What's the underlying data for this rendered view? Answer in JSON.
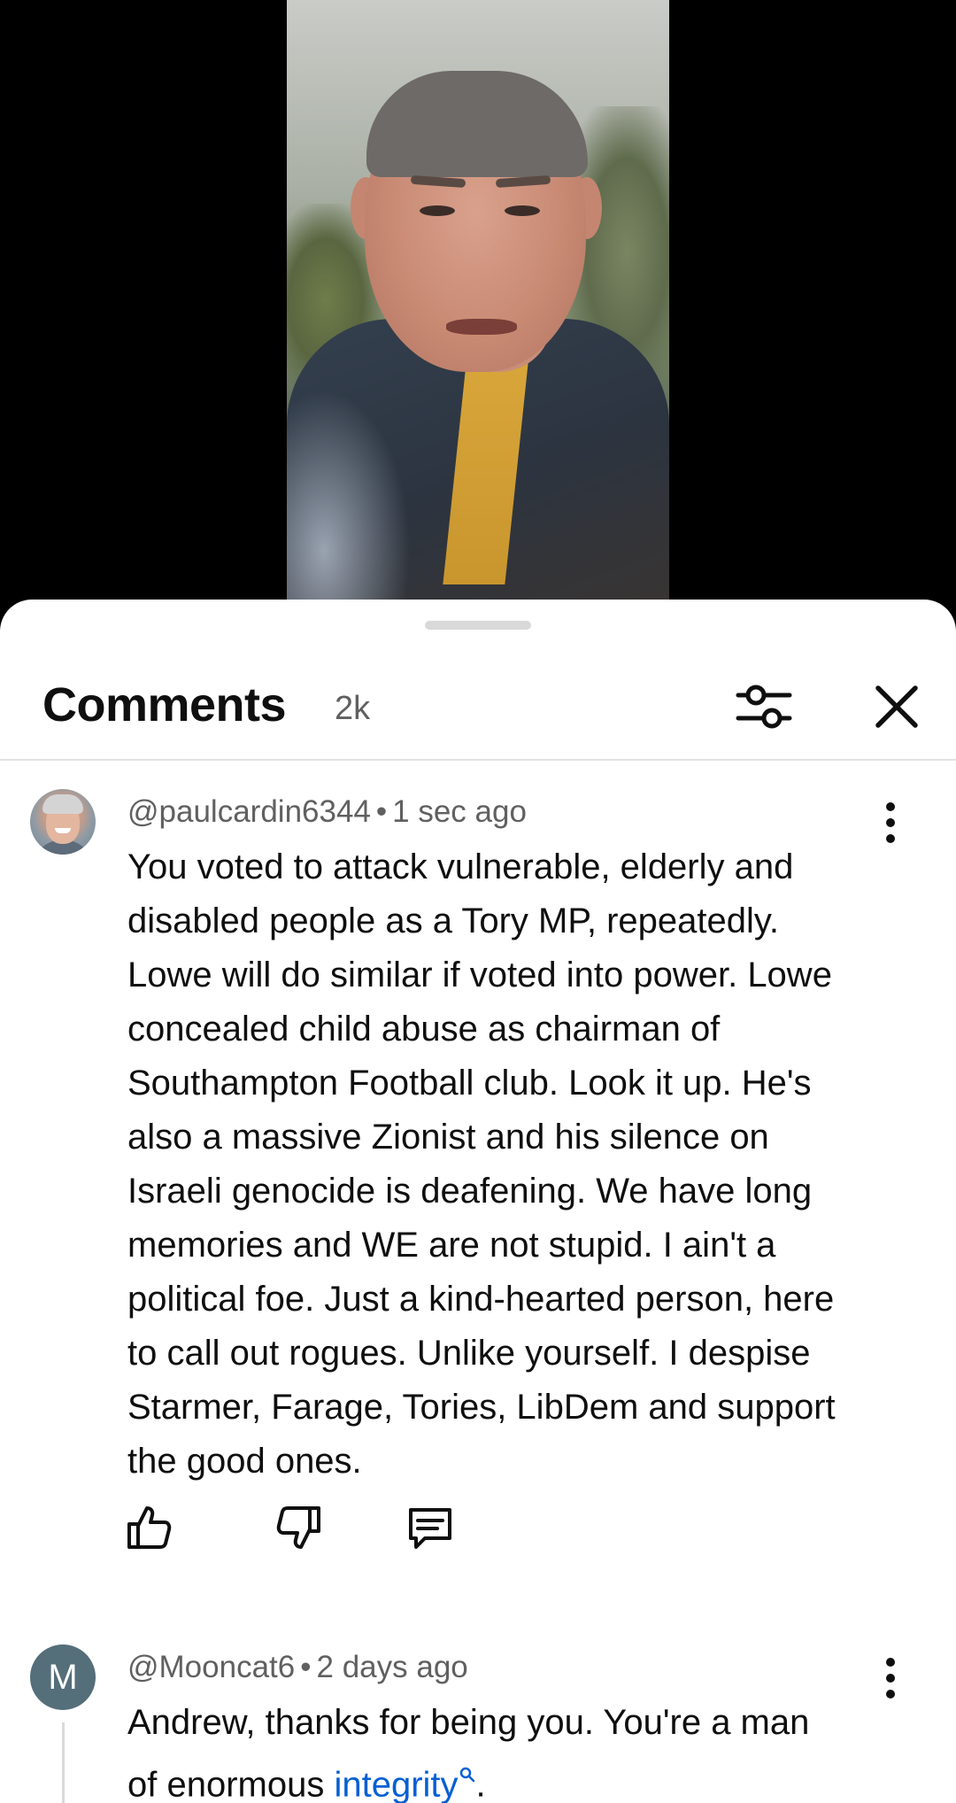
{
  "header": {
    "title": "Comments",
    "count": "2k",
    "filter_icon": "sliders-icon",
    "close_icon": "close-icon"
  },
  "comments": [
    {
      "author": "@paulcardin6344",
      "time": "1 sec ago",
      "avatar": "photo",
      "text_lines": [
        "You voted to attack vulnerable, elderly and",
        "disabled people as a Tory MP, repeatedly.",
        "Lowe will do similar if voted into power. Lowe",
        "concealed child abuse as chairman of",
        "Southampton Football club. Look it up. He's",
        "also a massive Zionist and his silence on",
        "Israeli genocide is deafening. We have long",
        "memories and WE are not stupid. I ain't a",
        "political foe. Just a kind-hearted person, here",
        "to call out rogues. Unlike yourself. I despise",
        "Starmer, Farage, Tories, LibDem and support",
        "the good ones."
      ]
    },
    {
      "author": "@Mooncat6",
      "time": "2 days ago",
      "avatar_letter": "M",
      "text_line_1": "Andrew,  thanks for being you.  You're a man",
      "text_line_2_prefix": "of enormous ",
      "text_line_2_link": "integrity",
      "text_line_2_suffix": "."
    }
  ],
  "colors": {
    "text_primary": "#0f0f0f",
    "text_secondary": "#606060",
    "link": "#065fd4",
    "avatar_letter_bg": "#546e7a"
  },
  "separator": "•"
}
